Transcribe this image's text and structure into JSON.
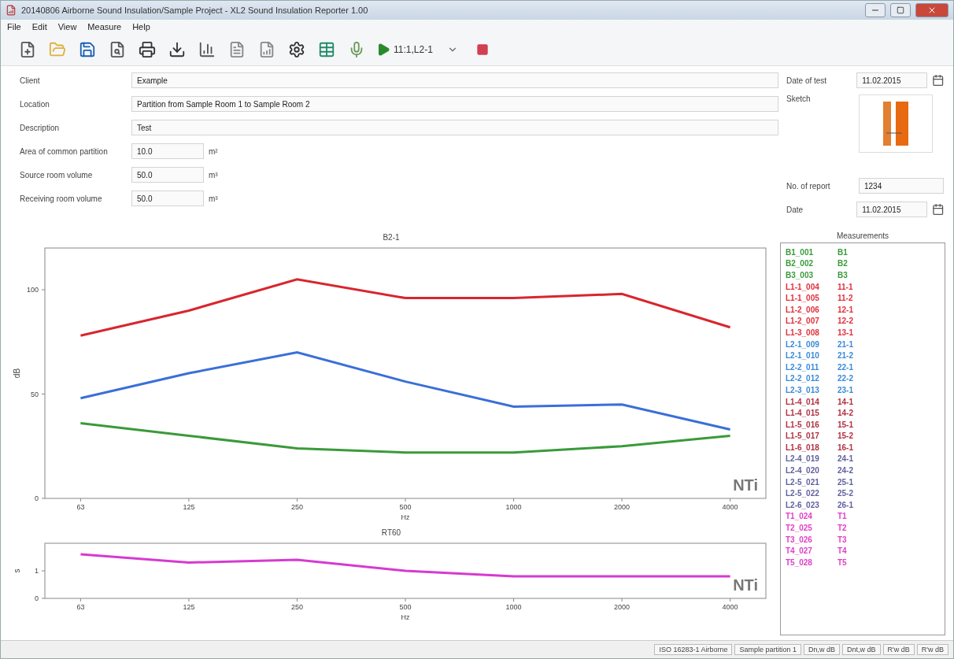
{
  "window": {
    "title": "20140806 Airborne Sound Insulation/Sample Project - XL2 Sound Insulation Reporter 1.00"
  },
  "menu": [
    "File",
    "Edit",
    "View",
    "Measure",
    "Help"
  ],
  "toolbar": {
    "run_label": "11:1,L2-1"
  },
  "form": {
    "fields": [
      {
        "label": "Client",
        "value": "Example"
      },
      {
        "label": "Location",
        "value": "Partition from Sample Room 1 to Sample Room 2"
      },
      {
        "label": "Description",
        "value": "Test"
      },
      {
        "label": "Area of common partition",
        "value": "10.0",
        "unit": "m²"
      },
      {
        "label": "Source room volume",
        "value": "50.0",
        "unit": "m³"
      },
      {
        "label": "Receiving room volume",
        "value": "50.0",
        "unit": "m³"
      }
    ],
    "date_of_test": {
      "label": "Date of test",
      "value": "11.02.2015"
    },
    "sketch": {
      "label": "Sketch"
    },
    "report_no": {
      "label": "No. of report",
      "value": "1234"
    },
    "date": {
      "label": "Date",
      "value": "11.02.2015"
    }
  },
  "charts": [
    {
      "title": "B2-1",
      "logo": "NTi",
      "chart_data": {
        "type": "line",
        "xlabel": "Hz",
        "ylabel": "dB",
        "categories": [
          "63",
          "125",
          "250",
          "500",
          "1000",
          "2000",
          "4000"
        ],
        "ylim": [
          0,
          120
        ],
        "yticks": [
          0,
          50,
          100
        ],
        "series": [
          {
            "color": "#d8262e",
            "values": [
              78,
              90,
              105,
              96,
              96,
              98,
              82
            ]
          },
          {
            "color": "#3a6fd8",
            "values": [
              48,
              60,
              70,
              56,
              44,
              45,
              33
            ]
          },
          {
            "color": "#3a9a3a",
            "values": [
              36,
              30,
              24,
              22,
              22,
              25,
              30
            ]
          }
        ]
      }
    },
    {
      "title": "RT60",
      "logo": "NTi",
      "chart_data": {
        "type": "line",
        "xlabel": "Hz",
        "ylabel": "s",
        "categories": [
          "63",
          "125",
          "250",
          "500",
          "1000",
          "2000",
          "4000"
        ],
        "ylim": [
          0,
          2
        ],
        "yticks": [
          0,
          1
        ],
        "series": [
          {
            "color": "#d63ad0",
            "values": [
              1.6,
              1.3,
              1.4,
              1.0,
              0.8,
              0.8,
              0.8
            ]
          }
        ]
      }
    }
  ],
  "measurements": {
    "title": "Measurements",
    "items": [
      {
        "name": "B1_001",
        "tag": "B1",
        "color": "#3a9a3a"
      },
      {
        "name": "B2_002",
        "tag": "B2",
        "color": "#3a9a3a"
      },
      {
        "name": "B3_003",
        "tag": "B3",
        "color": "#3a9a3a"
      },
      {
        "name": "L1-1_004",
        "tag": "11-1",
        "color": "#e0303a"
      },
      {
        "name": "L1-1_005",
        "tag": "11-2",
        "color": "#e0303a"
      },
      {
        "name": "L1-2_006",
        "tag": "12-1",
        "color": "#e0303a"
      },
      {
        "name": "L1-2_007",
        "tag": "12-2",
        "color": "#e0303a"
      },
      {
        "name": "L1-3_008",
        "tag": "13-1",
        "color": "#e0303a"
      },
      {
        "name": "L2-1_009",
        "tag": "21-1",
        "color": "#3a8ad8"
      },
      {
        "name": "L2-1_010",
        "tag": "21-2",
        "color": "#3a8ad8"
      },
      {
        "name": "L2-2_011",
        "tag": "22-1",
        "color": "#3a8ad8"
      },
      {
        "name": "L2-2_012",
        "tag": "22-2",
        "color": "#3a8ad8"
      },
      {
        "name": "L2-3_013",
        "tag": "23-1",
        "color": "#3a8ad8"
      },
      {
        "name": "L1-4_014",
        "tag": "14-1",
        "color": "#b03040"
      },
      {
        "name": "L1-4_015",
        "tag": "14-2",
        "color": "#b03040"
      },
      {
        "name": "L1-5_016",
        "tag": "15-1",
        "color": "#b03040"
      },
      {
        "name": "L1-5_017",
        "tag": "15-2",
        "color": "#b03040"
      },
      {
        "name": "L1-6_018",
        "tag": "16-1",
        "color": "#b03040"
      },
      {
        "name": "L2-4_019",
        "tag": "24-1",
        "color": "#6060a0"
      },
      {
        "name": "L2-4_020",
        "tag": "24-2",
        "color": "#6060a0"
      },
      {
        "name": "L2-5_021",
        "tag": "25-1",
        "color": "#6060a0"
      },
      {
        "name": "L2-5_022",
        "tag": "25-2",
        "color": "#6060a0"
      },
      {
        "name": "L2-6_023",
        "tag": "26-1",
        "color": "#6060a0"
      },
      {
        "name": "T1_024",
        "tag": "T1",
        "color": "#e040c8"
      },
      {
        "name": "T2_025",
        "tag": "T2",
        "color": "#e040c8"
      },
      {
        "name": "T3_026",
        "tag": "T3",
        "color": "#e040c8"
      },
      {
        "name": "T4_027",
        "tag": "T4",
        "color": "#e040c8"
      },
      {
        "name": "T5_028",
        "tag": "T5",
        "color": "#e040c8"
      }
    ]
  },
  "status_bar": [
    "ISO 16283-1 Airborne",
    "Sample partition 1",
    "Dn,w dB",
    "Dnt,w dB",
    "R'w dB",
    "R'w dB"
  ]
}
